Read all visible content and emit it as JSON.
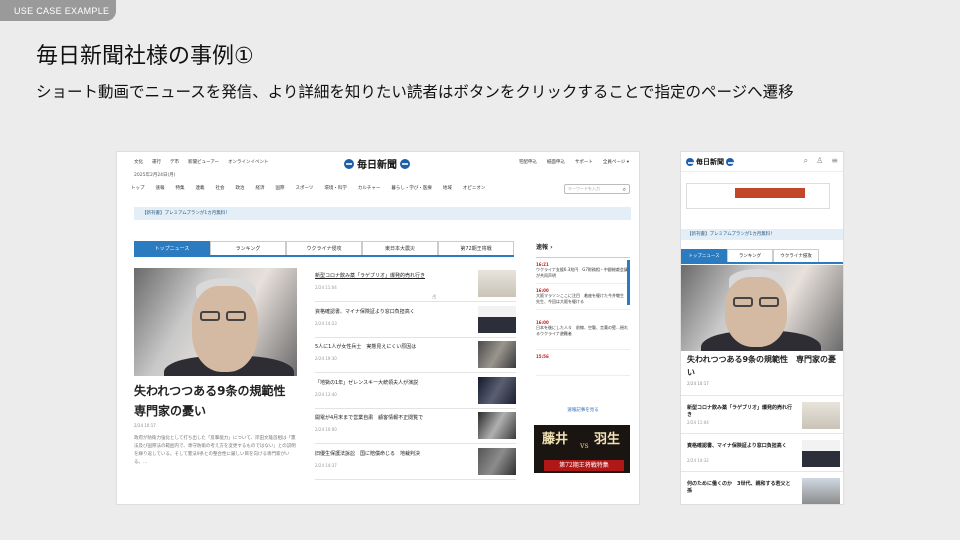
{
  "slide": {
    "tag": "USE CASE EXAMPLE",
    "title": "毎日新聞社様の事例①",
    "subtitle": "ショート動画でニュースを発信、より詳細を知りたい読者はボタンをクリックすることで指定のページへ遷移"
  },
  "desktop": {
    "utility_links": [
      "文化",
      "運行",
      "デ市",
      "新聞ビューアー",
      "オンラインイベント"
    ],
    "utility_right": [
      "宅配申込",
      "紙面申込",
      "サポート",
      "全員ページ ▾"
    ],
    "logo": "毎日新聞",
    "date": "2025年2月24日(月)",
    "nav": [
      "トップ",
      "速報",
      "特集",
      "連載",
      "社会",
      "政治",
      "経済",
      "国際",
      "スポーツ",
      "環境・科学",
      "カルチャー",
      "暮らし・学び・医療",
      "地域",
      "オピニオン"
    ],
    "search_placeholder": "キーワードを入力",
    "banner": "【新刊書】プレミアムプランが1カ月無料！",
    "tabs": [
      "トップニュース",
      "ランキング",
      "ウクライナ侵攻",
      "東日本大震災",
      "第72期王将戦"
    ],
    "hero": {
      "title": "失われつつある9条の規範性　専門家の憂い",
      "meta": "2/24 10:17",
      "snippet": "政府が防衛力強化として打ち出した「反撃能力」について、岸田文雄首相は「憲法及び国際法の範囲内で、専守防衛の考え方を変更するものではない」との説明を繰り返している。そして憲法9条との整合性に厳しい目を向ける専門家がいる。…"
    },
    "list": [
      {
        "title": "新型コロナ飲み薬「ラゲブリオ」爆発的売れ行き",
        "meta": "2/24 11:04"
      },
      {
        "title": "資格確認書、マイナ保険証より窓口負担高く",
        "meta": "2/24 14:23"
      },
      {
        "title": "5人に1人が女性兵士　実態見えにくい原因は",
        "meta": "2/24 19:30"
      },
      {
        "title": "「地獄の1年」ゼレンスキー大統領夫人が演説",
        "meta": "2/24 13:40"
      },
      {
        "title": "開電が4月末まで営業自粛　顧客情報不正閲覧で",
        "meta": "2/24 10:00"
      },
      {
        "title": "旧優生保護法訴訟　国に賠償命じる　地裁判決",
        "meta": "2/24 14:37"
      }
    ],
    "breaking": {
      "heading": "速報",
      "items": [
        {
          "time": "16:21",
          "text": "ウクライナ支援6.3兆円　G7財務相・中銀総裁会議が共同声明"
        },
        {
          "time": "16:00",
          "text": "大阪マラソンここに注目　着座を駆けた今井敬生　先生、今回は大阪を駆ける"
        },
        {
          "time": "16:00",
          "text": "日本を後にした人々　前線、空襲、言葉の壁…揺れるウクライナ避難者"
        },
        {
          "time": "15:56",
          "text": ""
        }
      ],
      "more": "速報記事を見る"
    },
    "ad": {
      "left": "藤井",
      "right": "羽生",
      "caption": "第72期王将戦特集"
    }
  },
  "mobile": {
    "logo": "毎日新聞",
    "banner": "【新刊書】プレミアムプランが1カ月無料！",
    "tabs": [
      "トップニュース",
      "ランキング",
      "ウクライナ侵攻"
    ],
    "hero_title": "失われつつある9条の規範性　専門家の憂い",
    "hero_meta": "2/24 10:17",
    "list": [
      {
        "title": "新型コロナ飲み薬「ラゲブリオ」爆発的売れ行き",
        "meta": "2/24 11:04"
      },
      {
        "title": "資格確認書、マイナ保険証より窓口負担高く",
        "meta": "2/24 14:32"
      },
      {
        "title": "何のために働くのか　3世代、親和する若父と孫",
        "meta": ""
      }
    ]
  }
}
